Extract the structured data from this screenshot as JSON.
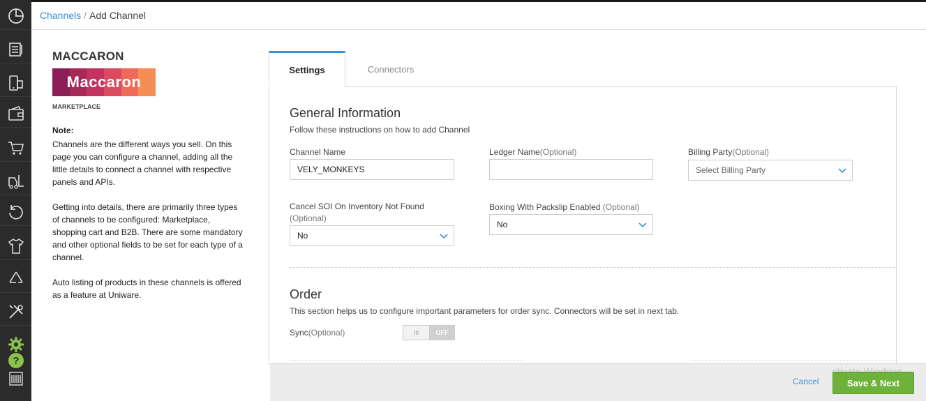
{
  "breadcrumb": {
    "parent": "Channels",
    "separator": "/",
    "current": "Add Channel"
  },
  "channel": {
    "name": "MACCARON",
    "logo_text": "Maccaron",
    "type": "MARKETPLACE",
    "logo_colors": [
      "#8b1f55",
      "#a52a5a",
      "#c2335f",
      "#db4a5f",
      "#ee6a5a",
      "#f58e55"
    ]
  },
  "note": {
    "label": "Note:",
    "paragraphs": [
      "Channels are the different ways you sell. On this page you can configure a channel, adding all the little details to connect a channel with respective panels and APIs.",
      "Getting into details, there are primarily three types of channels to be configured: Marketplace, shopping cart and B2B. There are some mandatory and other optional fields to be set for each type of a channel.",
      "Auto listing of products in these channels is offered as a feature at Uniware."
    ]
  },
  "tabs": [
    {
      "label": "Settings",
      "active": true
    },
    {
      "label": "Connectors",
      "active": false
    }
  ],
  "general": {
    "title": "General Information",
    "subtitle": "Follow these instructions on how to add Channel",
    "channel_name_label": "Channel Name",
    "channel_name_value": "VELY_MONKEYS",
    "ledger_label": "Ledger Name",
    "ledger_optional": "(Optional)",
    "ledger_value": "",
    "billing_label": "Billing Party",
    "billing_optional": "(Optional)",
    "billing_placeholder": "Select Billing Party",
    "cancel_soi_label": "Cancel SOI On Inventory Not Found",
    "cancel_soi_optional": "(Optional)",
    "cancel_soi_value": "No",
    "boxing_label": "Boxing With Packslip Enabled",
    "boxing_optional": "(Optional)",
    "boxing_value": "No"
  },
  "order": {
    "title": "Order",
    "subtitle": "This section helps us to configure important parameters for order sync. Connectors will be set in next tab.",
    "sync_label": "Sync",
    "sync_optional": "(Optional)",
    "sync_knob": "III",
    "sync_state": "OFF"
  },
  "footer": {
    "cancel_label": "Cancel",
    "save_label": "Save & Next",
    "watermark": "ctivate Windows"
  },
  "rail_icons": [
    "dashboard-icon",
    "orders-icon",
    "devices-icon",
    "wallet-icon",
    "cart-icon",
    "forklift-icon",
    "returns-icon",
    "apparel-icon",
    "recycle-icon",
    "tools-icon",
    "settings-icon",
    "help-icon",
    "barcode-icon"
  ],
  "colors": {
    "accent": "#3a8fd9",
    "save_button": "#6fb23b",
    "rail_bg": "#2b2b2b",
    "help_icon": "#8bc34a"
  }
}
